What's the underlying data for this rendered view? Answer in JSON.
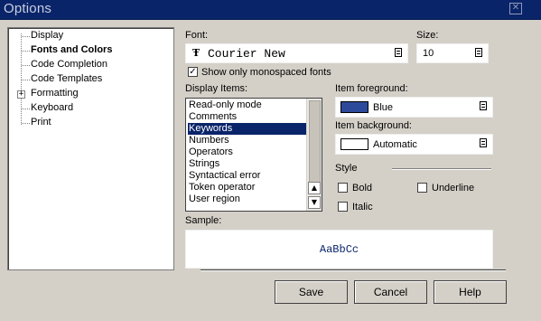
{
  "window": {
    "title": "Options",
    "close_glyph": "✕"
  },
  "tree": {
    "items": [
      {
        "label": "Display",
        "selected": false
      },
      {
        "label": "Fonts and Colors",
        "selected": true
      },
      {
        "label": "Code Completion",
        "selected": false
      },
      {
        "label": "Code Templates",
        "selected": false
      },
      {
        "label": "Formatting",
        "selected": false,
        "expandable": true
      },
      {
        "label": "Keyboard",
        "selected": false
      },
      {
        "label": "Print",
        "selected": false
      }
    ],
    "expander_glyph": "+"
  },
  "font": {
    "label": "Font:",
    "value": "Courier New",
    "icon": "font-icon",
    "icon_glyph": "Ŧ"
  },
  "size": {
    "label": "Size:",
    "value": "10"
  },
  "monospace": {
    "label": "Show only monospaced fonts",
    "checked": true,
    "check_glyph": "✓"
  },
  "display_items": {
    "label": "Display Items:",
    "items": [
      "Read-only mode",
      "Comments",
      "Keywords",
      "Numbers",
      "Operators",
      "Strings",
      "Syntactical error",
      "Token operator",
      "User region"
    ],
    "selected": "Keywords",
    "scroll_up_glyph": "▲",
    "scroll_down_glyph": "▼"
  },
  "foreground": {
    "label": "Item foreground:",
    "value": "Blue",
    "color": "#2d4a9a"
  },
  "background": {
    "label": "Item background:",
    "value": "Automatic",
    "color": "#ffffff"
  },
  "style": {
    "label": "Style",
    "bold": {
      "label": "Bold",
      "checked": false
    },
    "italic": {
      "label": "Italic",
      "checked": false
    },
    "underline": {
      "label": "Underline",
      "checked": false
    }
  },
  "sample": {
    "label": "Sample:",
    "text": "AaBbCc"
  },
  "buttons": {
    "save": "Save",
    "cancel": "Cancel",
    "help": "Help"
  },
  "colors": {
    "title_bar": "#0a246a",
    "selection": "#0a246a",
    "dialog": "#d4d0c8"
  }
}
